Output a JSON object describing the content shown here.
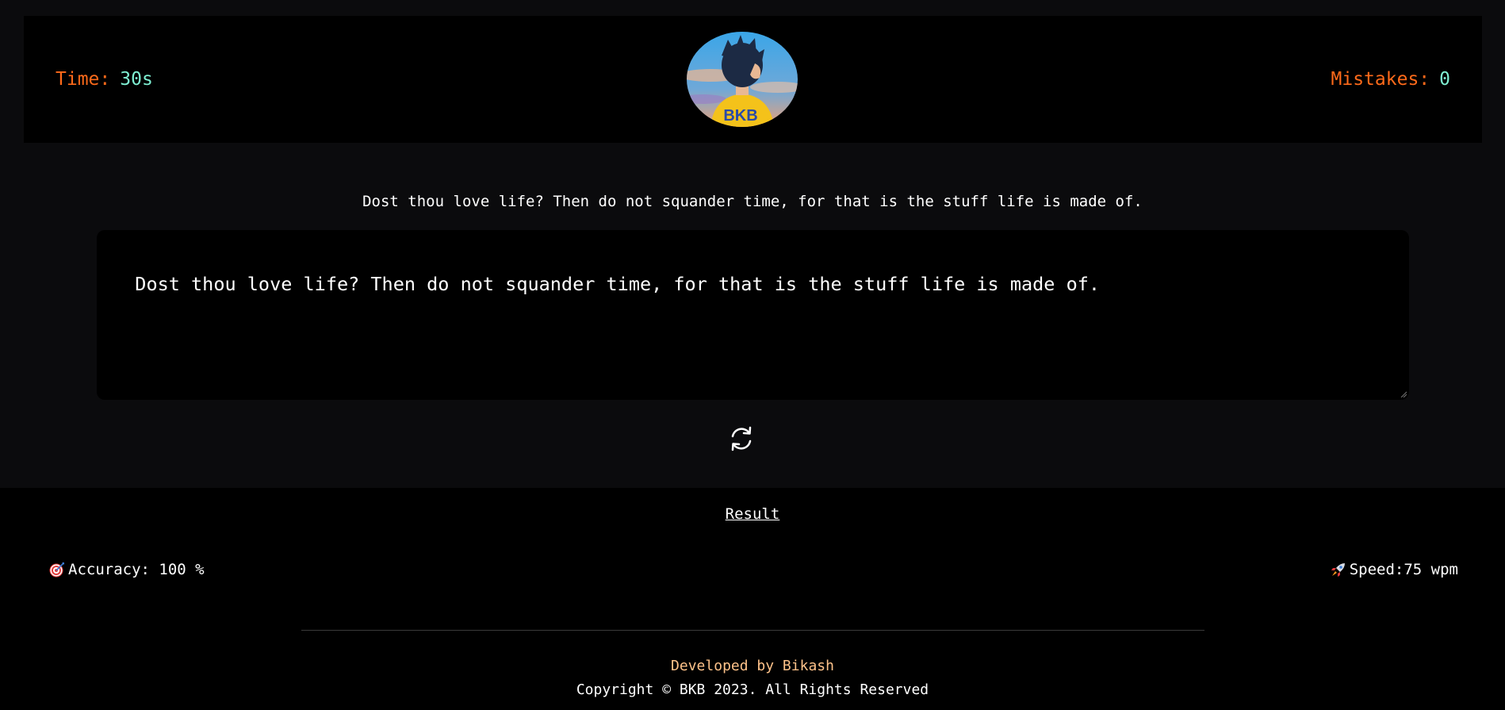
{
  "header": {
    "time_label": "Time:",
    "time_value": "30s",
    "mistakes_label": "Mistakes:",
    "mistakes_value": "0",
    "avatar_text": "BKB"
  },
  "quote": "Dost thou love life? Then do not squander time, for that is the stuff life is made of.",
  "typing_input": {
    "value": "Dost thou love life? Then do not squander time, for that is the stuff life is made of."
  },
  "reset": {
    "icon": "refresh-icon"
  },
  "result": {
    "title": "Result",
    "accuracy_label": "Accuracy: 100 %",
    "accuracy_icon": "target-icon",
    "speed_label": "Speed:75 wpm",
    "speed_icon": "rocket-icon"
  },
  "footer": {
    "developed_by": "Developed by Bikash",
    "copyright": "Copyright © BKB 2023. All Rights Reserved"
  },
  "colors": {
    "label_orange": "#ff6a1a",
    "value_teal": "#7ff0d3",
    "developer_peach": "#ffc38a"
  }
}
